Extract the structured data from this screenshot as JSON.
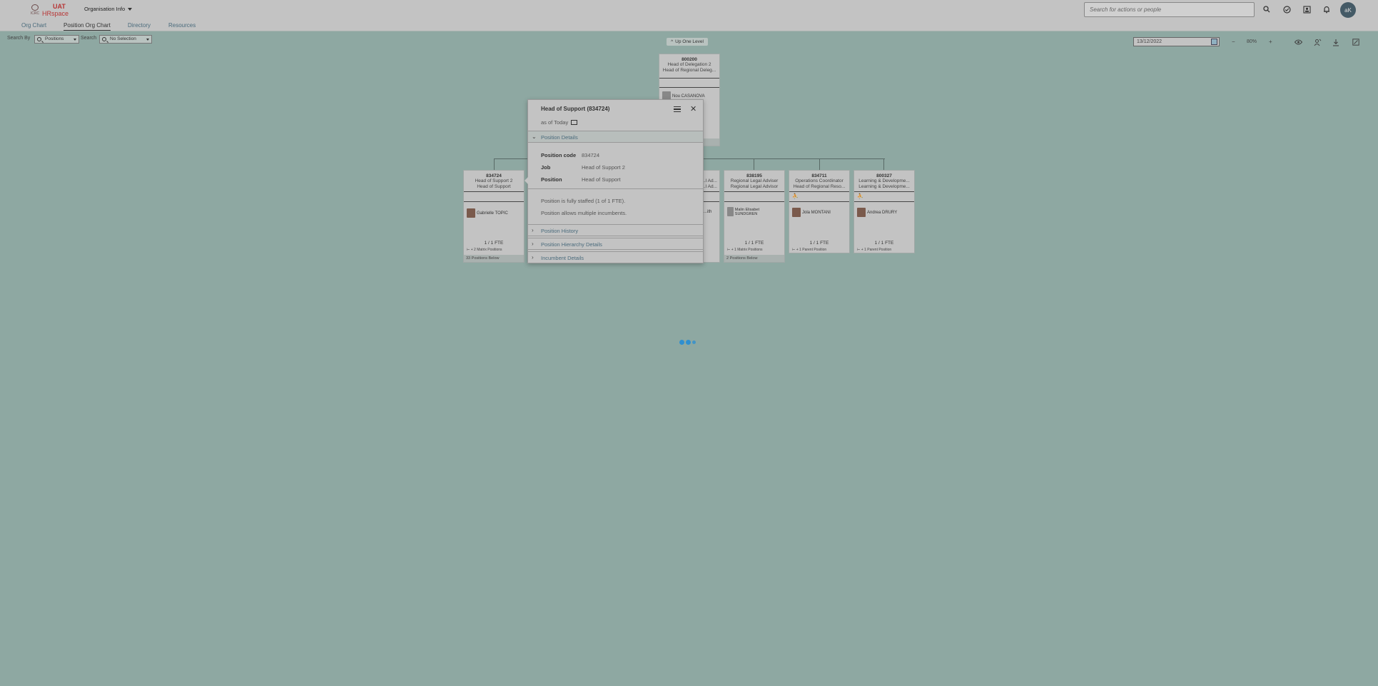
{
  "shell": {
    "logo_org": "ICRC",
    "logo_uat": "UAT",
    "logo_app": "HRspace",
    "menu_label": "Organisation Info",
    "search_placeholder": "Search for actions or people",
    "avatar_initials": "aK"
  },
  "tabs": [
    "Org Chart",
    "Position Org Chart",
    "Directory",
    "Resources"
  ],
  "active_tab": "Position Org Chart",
  "filters": {
    "search_by_label": "Search By",
    "search_by_value": "Positions",
    "search_label": "Search",
    "search_value": "No Selection"
  },
  "toolbar": {
    "up_one_level": "Up One Level",
    "date": "13/12/2022",
    "zoom": "80%",
    "zoom_out": "−",
    "zoom_in": "+"
  },
  "top_card": {
    "code": "800200",
    "title1": "Head of Delegation 2",
    "title2": "Head of Regional Deleg...",
    "person": "Nou CASANOVA"
  },
  "cards": [
    {
      "code": "834724",
      "title1": "Head of Support 2",
      "title2": "Head of Support",
      "person": "Gabrielle TOPIC",
      "fte": "1 / 1 FTE",
      "foot": "+ 2 Matrix Positions",
      "below": "33 Positions Below"
    },
    {
      "code": "838195",
      "title1": "Regional Legal Adviser",
      "title2": "Regional Legal Advisor",
      "person": "Malin Elisabet SUNDGREN",
      "fte": "1 / 1 FTE",
      "foot": "+ 1 Matrix Positions",
      "below": "2 Positions Below"
    },
    {
      "code": "834711",
      "title1": "Operations Coordinator",
      "title2": "Head of Regional Reso...",
      "person": "Jola MONTANI",
      "fte": "1 / 1 FTE",
      "foot": "+ 1 Parent Position"
    },
    {
      "code": "800327",
      "title1": "Learning & Developme...",
      "title2": "Learning & Developme...",
      "person": "Andrea DRURY",
      "fte": "1 / 1 FTE",
      "foot": "+ 1 Parent Position"
    }
  ],
  "partial_card": {
    "title1": "...l Ad...",
    "title2": "...l Ad...",
    "person": "...ith"
  },
  "popover": {
    "title": "Head of Support (834724)",
    "as_of": "as of Today",
    "section_details": "Position Details",
    "fields": [
      {
        "key": "Position code",
        "value": "834724"
      },
      {
        "key": "Job",
        "value": "Head of Support 2"
      },
      {
        "key": "Position",
        "value": "Head of Support"
      }
    ],
    "notes": [
      "Position is fully staffed (1 of 1 FTE).",
      "Position allows multiple incumbents."
    ],
    "sections": [
      "Position History",
      "Position Hierarchy Details",
      "Incumbent Details"
    ]
  },
  "colors": {
    "background": "#8ea8a2",
    "shell": "#c3c3c3",
    "link": "#4a6b7c",
    "brand": "#b73535",
    "loader": "#2f8fd0"
  }
}
